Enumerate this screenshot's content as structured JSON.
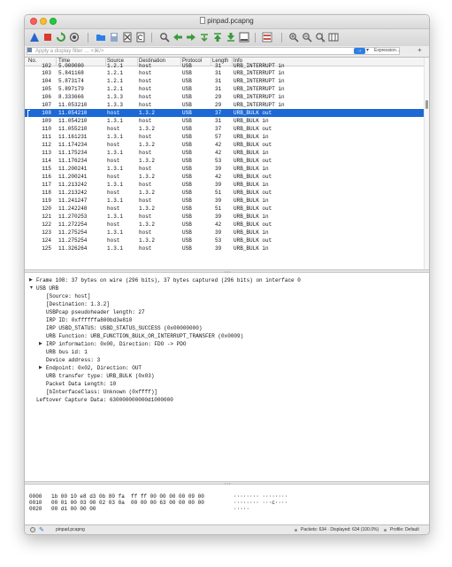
{
  "window": {
    "title": "pinpad.pcapng"
  },
  "toolbar": {
    "buttons": [
      {
        "name": "shark-fin-start-icon",
        "color": "#2a63c9"
      },
      {
        "name": "stop-capture-icon",
        "color": "#d83a2e"
      },
      {
        "name": "restart-capture-icon",
        "color": "#3a9a3a"
      },
      {
        "name": "capture-options-icon",
        "color": "#555555"
      },
      {
        "name": "open-file-icon",
        "color": "#2d7fe6"
      },
      {
        "name": "save-file-icon",
        "color": "#8ea8c9"
      },
      {
        "name": "close-file-icon",
        "color": "#555555"
      },
      {
        "name": "reload-file-icon",
        "color": "#555555"
      },
      {
        "name": "find-packet-icon",
        "color": "#555555"
      },
      {
        "name": "go-back-icon",
        "color": "#3a9a3a"
      },
      {
        "name": "go-forward-icon",
        "color": "#3a9a3a"
      },
      {
        "name": "go-to-packet-icon",
        "color": "#3a9a3a"
      },
      {
        "name": "go-first-icon",
        "color": "#3a9a3a"
      },
      {
        "name": "go-last-icon",
        "color": "#3a9a3a"
      },
      {
        "name": "auto-scroll-icon",
        "color": "#555555"
      },
      {
        "name": "colorize-icon",
        "color": "#c9574a"
      },
      {
        "name": "zoom-in-icon",
        "color": "#555555"
      },
      {
        "name": "zoom-out-icon",
        "color": "#555555"
      },
      {
        "name": "normal-size-icon",
        "color": "#555555"
      },
      {
        "name": "resize-columns-icon",
        "color": "#555555"
      }
    ]
  },
  "filter": {
    "placeholder": "Apply a display filter … <⌘/>",
    "expression_label": "Expression…",
    "add_label": "+"
  },
  "packet_list": {
    "columns": [
      "No.",
      "Time",
      "Source",
      "Destination",
      "Protocol",
      "Length",
      "Info"
    ],
    "partial_row": {
      "no": "102",
      "time": "5.000000",
      "src": "1.2.1",
      "dst": "host",
      "proto": "USB",
      "len": "31",
      "info": "URB_INTERRUPT in"
    },
    "rows": [
      {
        "no": "103",
        "time": "5.841168",
        "src": "1.2.1",
        "dst": "host",
        "proto": "USB",
        "len": "31",
        "info": "URB_INTERRUPT in"
      },
      {
        "no": "104",
        "time": "5.873174",
        "src": "1.2.1",
        "dst": "host",
        "proto": "USB",
        "len": "31",
        "info": "URB_INTERRUPT in"
      },
      {
        "no": "105",
        "time": "5.897179",
        "src": "1.2.1",
        "dst": "host",
        "proto": "USB",
        "len": "31",
        "info": "URB_INTERRUPT in"
      },
      {
        "no": "106",
        "time": "8.333666",
        "src": "1.3.3",
        "dst": "host",
        "proto": "USB",
        "len": "29",
        "info": "URB_INTERRUPT in"
      },
      {
        "no": "107",
        "time": "11.053210",
        "src": "1.3.3",
        "dst": "host",
        "proto": "USB",
        "len": "29",
        "info": "URB_INTERRUPT in"
      },
      {
        "no": "108",
        "time": "11.054210",
        "src": "host",
        "dst": "1.3.2",
        "proto": "USB",
        "len": "37",
        "info": "URB_BULK out",
        "selected": true
      },
      {
        "no": "109",
        "time": "11.054210",
        "src": "1.3.1",
        "dst": "host",
        "proto": "USB",
        "len": "31",
        "info": "URB_BULK in"
      },
      {
        "no": "110",
        "time": "11.055210",
        "src": "host",
        "dst": "1.3.2",
        "proto": "USB",
        "len": "37",
        "info": "URB_BULK out"
      },
      {
        "no": "111",
        "time": "11.161231",
        "src": "1.3.1",
        "dst": "host",
        "proto": "USB",
        "len": "57",
        "info": "URB_BULK in"
      },
      {
        "no": "112",
        "time": "11.174234",
        "src": "host",
        "dst": "1.3.2",
        "proto": "USB",
        "len": "42",
        "info": "URB_BULK out"
      },
      {
        "no": "113",
        "time": "11.175234",
        "src": "1.3.1",
        "dst": "host",
        "proto": "USB",
        "len": "42",
        "info": "URB_BULK in"
      },
      {
        "no": "114",
        "time": "11.176234",
        "src": "host",
        "dst": "1.3.2",
        "proto": "USB",
        "len": "53",
        "info": "URB_BULK out"
      },
      {
        "no": "115",
        "time": "11.200241",
        "src": "1.3.1",
        "dst": "host",
        "proto": "USB",
        "len": "39",
        "info": "URB_BULK in"
      },
      {
        "no": "116",
        "time": "11.200241",
        "src": "host",
        "dst": "1.3.2",
        "proto": "USB",
        "len": "42",
        "info": "URB_BULK out"
      },
      {
        "no": "117",
        "time": "11.213242",
        "src": "1.3.1",
        "dst": "host",
        "proto": "USB",
        "len": "39",
        "info": "URB_BULK in"
      },
      {
        "no": "118",
        "time": "11.213242",
        "src": "host",
        "dst": "1.3.2",
        "proto": "USB",
        "len": "51",
        "info": "URB_BULK out"
      },
      {
        "no": "119",
        "time": "11.241247",
        "src": "1.3.1",
        "dst": "host",
        "proto": "USB",
        "len": "39",
        "info": "URB_BULK in"
      },
      {
        "no": "120",
        "time": "11.242248",
        "src": "host",
        "dst": "1.3.2",
        "proto": "USB",
        "len": "51",
        "info": "URB_BULK out"
      },
      {
        "no": "121",
        "time": "11.270253",
        "src": "1.3.1",
        "dst": "host",
        "proto": "USB",
        "len": "39",
        "info": "URB_BULK in"
      },
      {
        "no": "122",
        "time": "11.272254",
        "src": "host",
        "dst": "1.3.2",
        "proto": "USB",
        "len": "42",
        "info": "URB_BULK out"
      },
      {
        "no": "123",
        "time": "11.275254",
        "src": "1.3.1",
        "dst": "host",
        "proto": "USB",
        "len": "39",
        "info": "URB_BULK in"
      },
      {
        "no": "124",
        "time": "11.275254",
        "src": "host",
        "dst": "1.3.2",
        "proto": "USB",
        "len": "53",
        "info": "URB_BULK out"
      },
      {
        "no": "125",
        "time": "11.326264",
        "src": "1.3.1",
        "dst": "host",
        "proto": "USB",
        "len": "39",
        "info": "URB_BULK in"
      }
    ]
  },
  "details": {
    "lines": [
      {
        "indent": 0,
        "expander": "collapsed",
        "text": "Frame 108: 37 bytes on wire (296 bits), 37 bytes captured (296 bits) on interface 0"
      },
      {
        "indent": 0,
        "expander": "expanded",
        "text": "USB URB"
      },
      {
        "indent": 1,
        "expander": "none",
        "text": "[Source: host]"
      },
      {
        "indent": 1,
        "expander": "none",
        "text": "[Destination: 1.3.2]"
      },
      {
        "indent": 1,
        "expander": "none",
        "text": "USBPcap pseudoheader length: 27"
      },
      {
        "indent": 1,
        "expander": "none",
        "text": "IRP ID: 0xffffffa800bd3e810"
      },
      {
        "indent": 1,
        "expander": "none",
        "text": "IRP USBD_STATUS: USBD_STATUS_SUCCESS (0x00000000)"
      },
      {
        "indent": 1,
        "expander": "none",
        "text": "URB Function: URB_FUNCTION_BULK_OR_INTERRUPT_TRANSFER (0x0009)"
      },
      {
        "indent": 1,
        "expander": "collapsed",
        "text": "IRP information: 0x00, Direction: FDO -> PDO"
      },
      {
        "indent": 1,
        "expander": "none",
        "text": "URB bus id: 1"
      },
      {
        "indent": 1,
        "expander": "none",
        "text": "Device address: 3"
      },
      {
        "indent": 1,
        "expander": "collapsed",
        "text": "Endpoint: 0x02, Direction: OUT"
      },
      {
        "indent": 1,
        "expander": "none",
        "text": "URB transfer type: URB_BULK (0x03)"
      },
      {
        "indent": 1,
        "expander": "none",
        "text": "Packet Data Length: 10"
      },
      {
        "indent": 1,
        "expander": "none",
        "text": "[bInterfaceClass: Unknown (0xffff)]"
      },
      {
        "indent": 0,
        "expander": "none",
        "text": "Leftover Capture Data: 630000000000d1000000"
      }
    ]
  },
  "bytes": {
    "lines": [
      {
        "offset": "0000",
        "hex": "1b 00 10 e8 d3 0b 80 fa  ff ff 00 00 00 00 09 00",
        "ascii": "········ ········"
      },
      {
        "offset": "0010",
        "hex": "00 01 00 03 00 02 03 0a  00 00 00 63 00 00 00 00",
        "ascii": "········ ···c····"
      },
      {
        "offset": "0020",
        "hex": "00 d1 00 00 00",
        "ascii": "·····"
      }
    ]
  },
  "status": {
    "file": "pinpad.pcapng",
    "packets": "Packets: 634 · Displayed: 634 (100.0%)",
    "profile": "Profile: Default"
  },
  "colors": {
    "selection": "#1b68d6",
    "accent": "#2d7fe6"
  }
}
